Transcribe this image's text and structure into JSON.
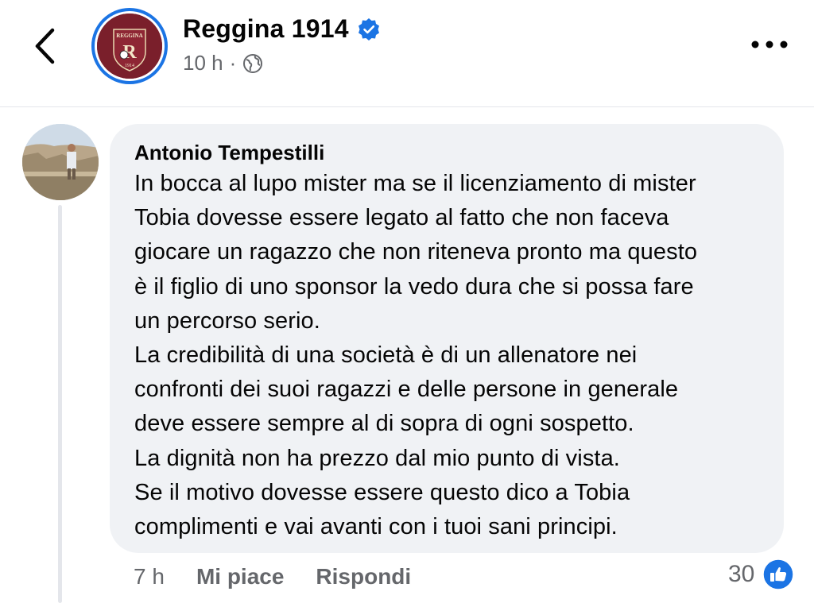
{
  "header": {
    "page_name": "Reggina 1914",
    "timestamp": "10 h",
    "separator": "·",
    "audience_icon": "globe-icon",
    "verified_icon": "verified-badge-icon",
    "logo_text": "REGGINA",
    "logo_year": "1914"
  },
  "comment": {
    "author": "Antonio Tempestilli",
    "text": "In bocca al lupo mister ma se il licenziamento di mister\nTobia dovesse essere legato al fatto che non faceva\ngiocare un ragazzo che non riteneva pronto ma questo\nè il figlio di uno sponsor la vedo dura che si possa fare\nun percorso serio.\nLa credibilità di una società è di un allenatore nei\nconfronti dei suoi ragazzi e delle persone in generale\ndeve essere sempre al di sopra di ogni sospetto.\nLa dignità non ha prezzo dal mio punto di vista.\nSe il motivo dovesse essere questo dico a Tobia\ncomplimenti e vai avanti con i tuoi sani principi.",
    "time": "7 h",
    "like_label": "Mi piace",
    "reply_label": "Rispondi",
    "reaction_count": "30"
  },
  "colors": {
    "accent": "#1b74e4",
    "bubble": "#f0f2f5",
    "secondary_text": "#65676b",
    "logo_maroon": "#7a1f2b"
  }
}
